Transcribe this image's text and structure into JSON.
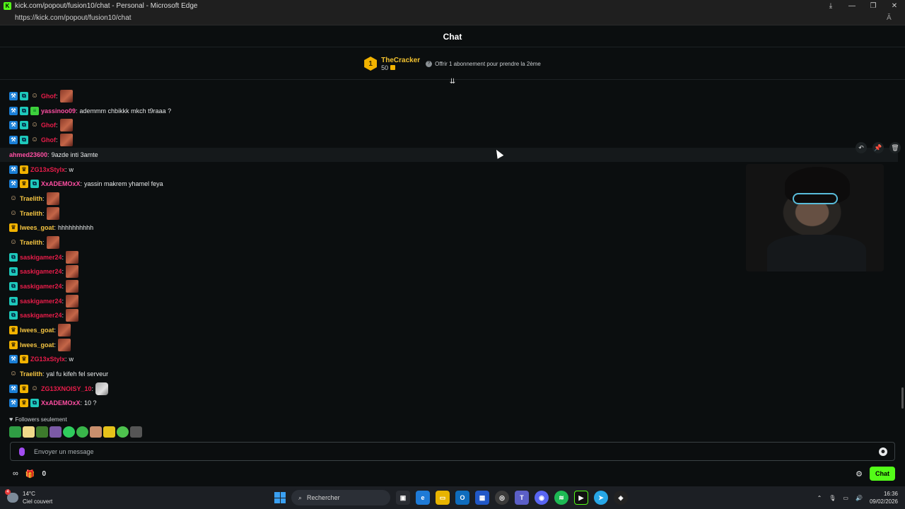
{
  "browser": {
    "title": "kick.com/popout/fusion10/chat - Personal - Microsoft Edge",
    "url": "https://kick.com/popout/fusion10/chat",
    "favicon_letter": "K",
    "min": "—",
    "restore": "❐",
    "close": "✕",
    "download_icon": "⤓",
    "read_aloud": "Ă"
  },
  "chat": {
    "title": "Chat",
    "top_gifter": {
      "rank": "1",
      "name": "TheCracker",
      "count": "50",
      "offer_text": "Offrir 1 abonnement pour prendre la 2ème"
    },
    "scroll_icon": "⇊",
    "messages": [
      {
        "user": "Ghof",
        "text": ""
      },
      {
        "user": "yassinoo09",
        "text": "ademmm chbikkk mkch t9raaa ?"
      },
      {
        "user": "Ghof",
        "text": ""
      },
      {
        "user": "Ghof",
        "text": ""
      },
      {
        "user": "ahmed23600",
        "text": "9azde inti 3amte"
      },
      {
        "user": "ZG13xStylx",
        "text": "w"
      },
      {
        "user": "XxADEMOxX",
        "text": "yassin makrem yhamel feya"
      },
      {
        "user": "Traelith",
        "text": ""
      },
      {
        "user": "Traelith",
        "text": ""
      },
      {
        "user": "lwees_goat",
        "text": "hhhhhhhhhh"
      },
      {
        "user": "Traelith",
        "text": ""
      },
      {
        "user": "saskigamer24",
        "text": ""
      },
      {
        "user": "saskigamer24",
        "text": ""
      },
      {
        "user": "saskigamer24",
        "text": ""
      },
      {
        "user": "saskigamer24",
        "text": ""
      },
      {
        "user": "saskigamer24",
        "text": ""
      },
      {
        "user": "lwees_goat",
        "text": ""
      },
      {
        "user": "lwees_goat",
        "text": ""
      },
      {
        "user": "ZG13xStylx",
        "text": "w"
      },
      {
        "user": "Traelith",
        "text": "yal fu kifeh fel serveur"
      },
      {
        "user": "ZG13XNOISY_10",
        "text": ""
      },
      {
        "user": "XxADEMOxX",
        "text": "10 ?"
      }
    ],
    "mod_actions": {
      "undo": "↶",
      "pin": "📌",
      "delete": "🗑"
    },
    "followers_only": "Followers seulement",
    "composer_placeholder": "Envoyer un message",
    "bottom": {
      "points_icon": "∞",
      "gift_count": "0",
      "settings_icon": "⚙",
      "chat_button": "Chat"
    }
  },
  "taskbar": {
    "temperature": "14°C",
    "weather": "Ciel couvert",
    "weather_badge": "4",
    "search_placeholder": "Rechercher",
    "time": "16:36",
    "date": "09/02/2026"
  },
  "colors": {
    "accent": "#53fc18",
    "username_red": "#e91d4a",
    "username_gold": "#f5c542",
    "background": "#0b0e0f"
  }
}
